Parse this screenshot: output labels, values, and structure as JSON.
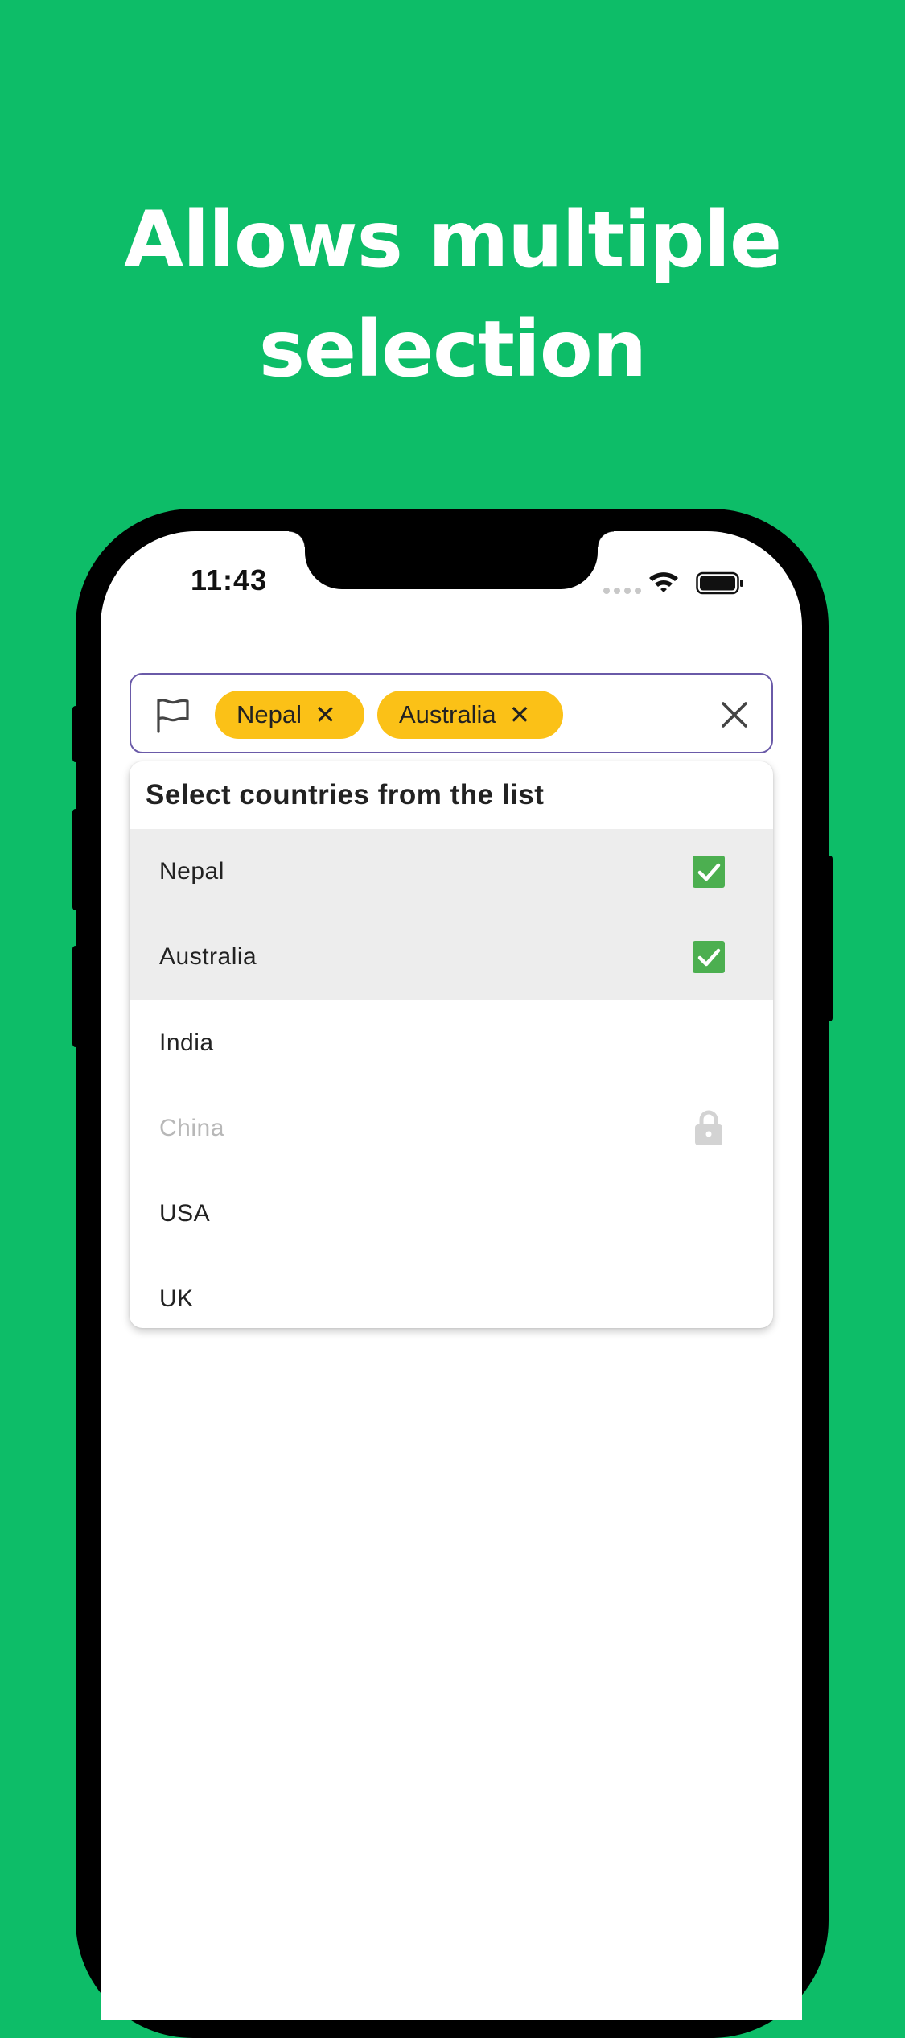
{
  "headline": {
    "line1": "Allows multiple",
    "line2": "selection"
  },
  "status_bar": {
    "time": "11:43"
  },
  "selector": {
    "leading_icon": "flag-icon",
    "chips": [
      {
        "label": "Nepal",
        "remove_icon": "close-icon"
      },
      {
        "label": "Australia",
        "remove_icon": "close-icon"
      }
    ],
    "clear_icon": "close-icon"
  },
  "dropdown": {
    "title": "Select countries from the list",
    "items": [
      {
        "label": "Nepal",
        "selected": true,
        "disabled": false,
        "icon": "checkbox-checked-icon"
      },
      {
        "label": "Australia",
        "selected": true,
        "disabled": false,
        "icon": "checkbox-checked-icon"
      },
      {
        "label": "India",
        "selected": false,
        "disabled": false,
        "icon": ""
      },
      {
        "label": "China",
        "selected": false,
        "disabled": true,
        "icon": "lock-icon"
      },
      {
        "label": "USA",
        "selected": false,
        "disabled": false,
        "icon": ""
      },
      {
        "label": "UK",
        "selected": false,
        "disabled": false,
        "icon": ""
      }
    ]
  },
  "colors": {
    "background": "#0dbd68",
    "chip": "#fbc117",
    "check": "#4caf50",
    "field_border": "#6a5aa8",
    "selected_row": "#ededed"
  }
}
